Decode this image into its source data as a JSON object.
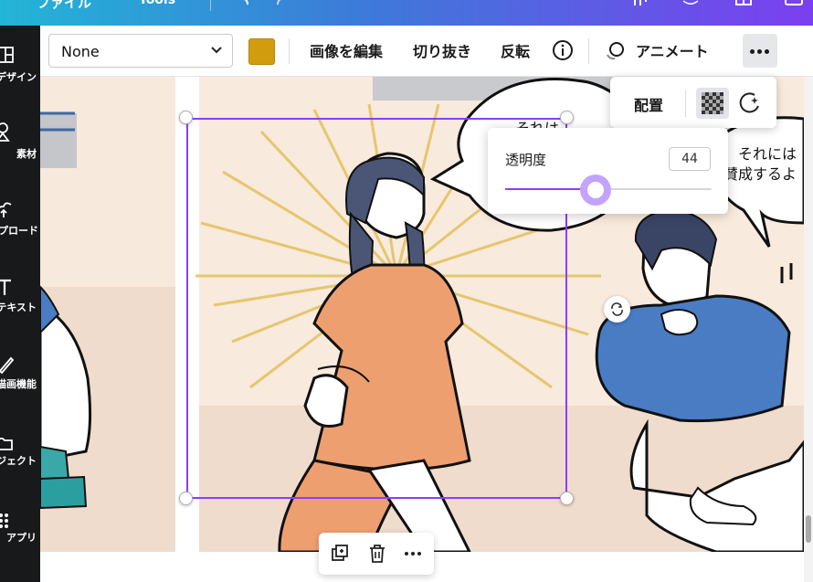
{
  "app": {
    "menu": [
      {
        "label": "ファイル"
      },
      {
        "label": "Tools"
      }
    ]
  },
  "sidebar": {
    "items": [
      {
        "label": "デザイン",
        "icon": "layout-icon"
      },
      {
        "label": "素材",
        "icon": "shapes-icon"
      },
      {
        "label": "アップロード",
        "icon": "upload-icon"
      },
      {
        "label": "テキスト",
        "icon": "text-icon"
      },
      {
        "label": "描画機能",
        "icon": "draw-icon"
      },
      {
        "label": "プロジェクト",
        "icon": "folder-icon"
      },
      {
        "label": "アプリ",
        "icon": "apps-icon"
      }
    ]
  },
  "toolbar": {
    "filter_select": "None",
    "color_swatch": "#d19d0f",
    "edit_image": "画像を編集",
    "crop": "切り抜き",
    "flip": "反転",
    "animate": "アニメート"
  },
  "position_popover": {
    "position_label": "配置"
  },
  "opacity_popover": {
    "label": "透明度",
    "value": "44",
    "slider_fraction": 0.44
  },
  "canvas": {
    "speech_left": "それは",
    "speech_right_line1": "それには",
    "speech_right_line2": "賛成するよ"
  },
  "colors": {
    "accent": "#8b3dff",
    "sidebar_bg": "#18191b",
    "header_start": "#22b5d6",
    "header_end": "#7b3ff0"
  }
}
